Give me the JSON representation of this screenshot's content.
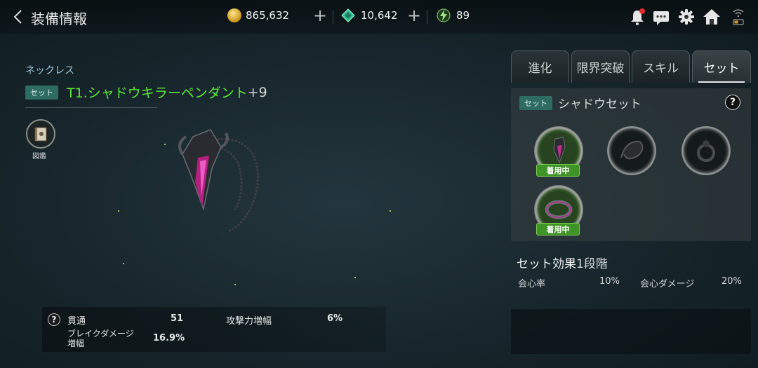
{
  "header": {
    "title": "装備情報",
    "gold": "865,632",
    "gems": "10,642",
    "stamina": "89"
  },
  "item": {
    "category": "ネックレス",
    "badge": "セット",
    "name": "T1.シャドウキラーペンダント",
    "enhance": "+9",
    "book_label": "図鑑"
  },
  "stats": [
    {
      "label": "貫通",
      "value": "51"
    },
    {
      "label": "攻撃力増幅",
      "value": "6%"
    },
    {
      "label": "ブレイクダメージ増幅",
      "value": "16.9%"
    }
  ],
  "tabs": [
    "進化",
    "限界突破",
    "スキル",
    "セット"
  ],
  "active_tab": "セット",
  "set": {
    "badge": "セット",
    "name": "シャドウセット",
    "help": "?",
    "worn_label": "着用中",
    "slots": [
      {
        "piece": "necklace",
        "equipped": true
      },
      {
        "piece": "dragon",
        "equipped": false
      },
      {
        "piece": "ring",
        "equipped": false
      },
      {
        "piece": "bracelet",
        "equipped": true
      }
    ]
  },
  "effect": {
    "title": "セット効果",
    "level": "1段階",
    "items": [
      {
        "label": "会心率",
        "value": "10%"
      },
      {
        "label": "会心ダメージ",
        "value": "20%"
      }
    ]
  },
  "colors": {
    "item_name": "#5ee83a",
    "badge": "#2d6b63",
    "worn": "#3f9427"
  }
}
